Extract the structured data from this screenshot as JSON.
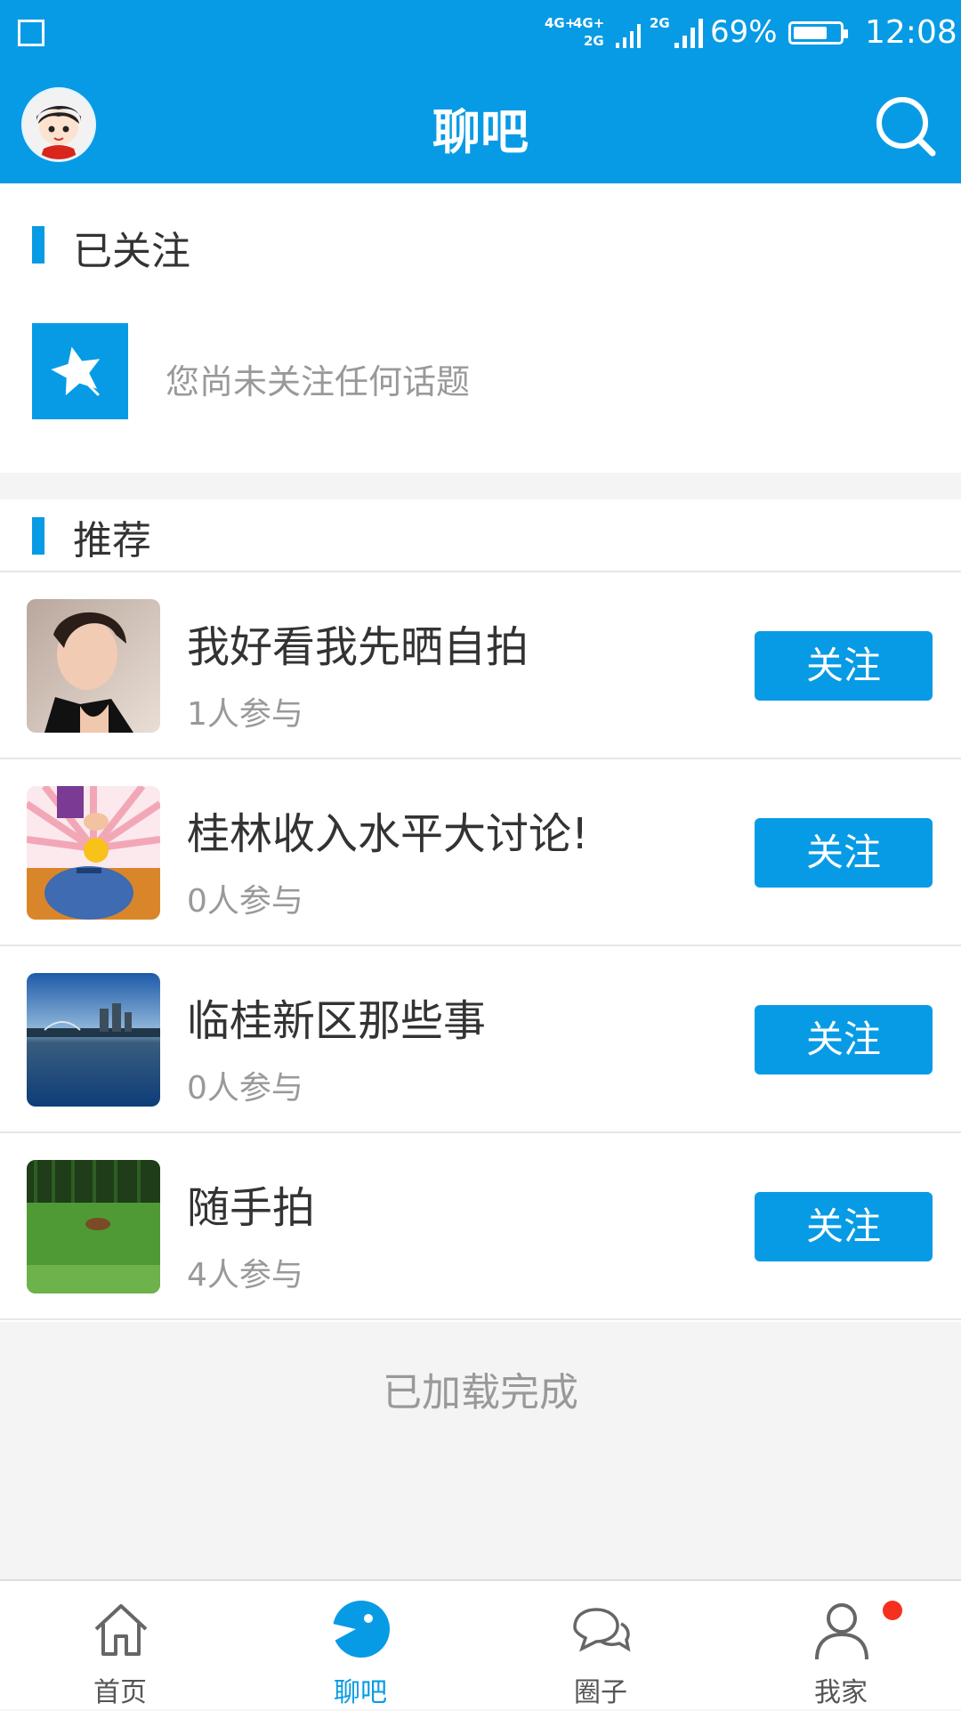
{
  "statusbar": {
    "network_1": "4G+",
    "network_2": "4G+",
    "network_3": "2G",
    "network_4": "2G",
    "battery": "69%",
    "battery_level": 0.69,
    "time": "12:08"
  },
  "header": {
    "title": "聊吧"
  },
  "followed": {
    "title": "已关注",
    "empty_text": "您尚未关注任何话题"
  },
  "recommend": {
    "title": "推荐",
    "items": [
      {
        "title": "我好看我先晒自拍",
        "participants": "1人参与",
        "button": "关注"
      },
      {
        "title": "桂林收入水平大讨论!",
        "participants": "0人参与",
        "button": "关注"
      },
      {
        "title": "临桂新区那些事",
        "participants": "0人参与",
        "button": "关注"
      },
      {
        "title": "随手拍",
        "participants": "4人参与",
        "button": "关注"
      }
    ]
  },
  "footer_text": "已加载完成",
  "tabbar": {
    "items": [
      {
        "label": "首页",
        "icon": "home-icon"
      },
      {
        "label": "聊吧",
        "icon": "chat-fish-icon"
      },
      {
        "label": "圈子",
        "icon": "speech-bubbles-icon"
      },
      {
        "label": "我家",
        "icon": "user-icon"
      }
    ],
    "active_index": 1,
    "colors": {
      "active": "#089be5",
      "inactive": "#555555",
      "badge": "#f5301e"
    }
  },
  "colors": {
    "brand": "#089be5",
    "background": "#f4f4f4"
  }
}
